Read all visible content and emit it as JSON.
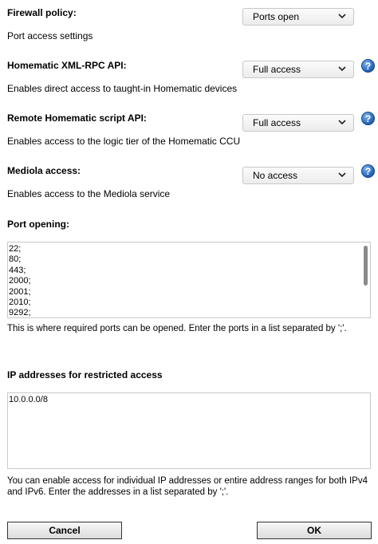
{
  "firewall": {
    "label": "Firewall policy:",
    "desc": "Port access settings",
    "value": "Ports open"
  },
  "xmlrpc": {
    "label": "Homematic XML-RPC API:",
    "desc": "Enables direct access to taught-in Homematic devices",
    "value": "Full access",
    "help": "?"
  },
  "script_api": {
    "label": "Remote Homematic script API:",
    "desc": "Enables access to the logic tier of the Homematic CCU",
    "value": "Full access",
    "help": "?"
  },
  "mediola": {
    "label": "Mediola access:",
    "desc": "Enables access to the Mediola service",
    "value": "No access",
    "help": "?"
  },
  "ports": {
    "label": "Port opening:",
    "lines": [
      "22;",
      "80;",
      "443;",
      "2000;",
      "2001;",
      "2010;",
      "9292;"
    ],
    "hint": "This is where required ports can be opened. Enter the ports in a list separated by ';'."
  },
  "ip": {
    "label": "IP addresses for restricted access",
    "lines": [
      "10.0.0.0/8"
    ],
    "hint_line1": "You can enable access for individual IP addresses or entire address ranges for both IPv4",
    "hint_line2": "and IPv6. Enter the addresses in a list separated by ';'."
  },
  "buttons": {
    "cancel": "Cancel",
    "ok": "OK"
  }
}
